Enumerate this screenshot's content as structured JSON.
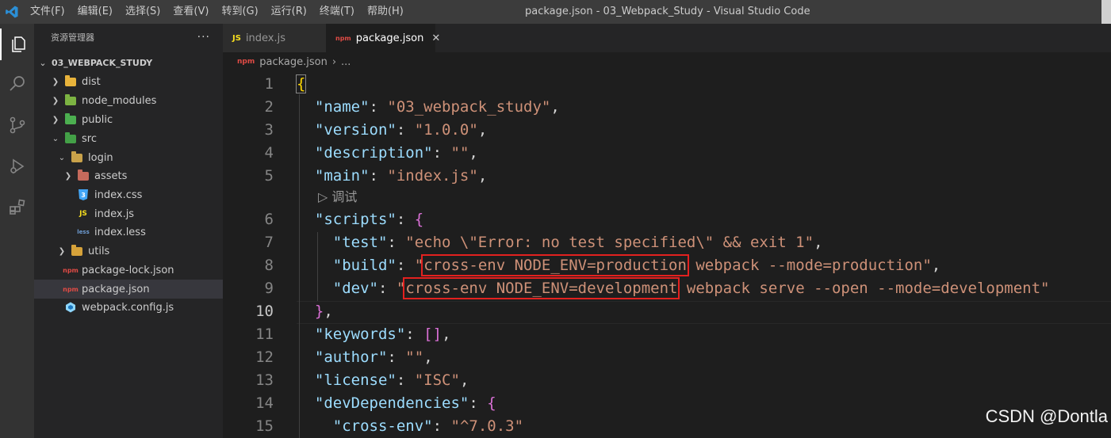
{
  "window": {
    "title": "package.json - 03_Webpack_Study - Visual Studio Code",
    "menu": [
      "文件(F)",
      "编辑(E)",
      "选择(S)",
      "查看(V)",
      "转到(G)",
      "运行(R)",
      "终端(T)",
      "帮助(H)"
    ]
  },
  "activity_bar": {
    "items": [
      {
        "icon": "files-icon",
        "active": true
      },
      {
        "icon": "search-icon",
        "active": false
      },
      {
        "icon": "source-control-icon",
        "active": false
      },
      {
        "icon": "run-debug-icon",
        "active": false
      },
      {
        "icon": "extensions-icon",
        "active": false
      }
    ]
  },
  "sidebar": {
    "title": "资源管理器",
    "more": "···",
    "project": "03_WEBPACK_STUDY",
    "tree": [
      {
        "label": "dist",
        "type": "folder",
        "state": "collapsed",
        "icon": "folder-dist-icon"
      },
      {
        "label": "node_modules",
        "type": "folder",
        "state": "collapsed",
        "icon": "folder-node-icon"
      },
      {
        "label": "public",
        "type": "folder",
        "state": "collapsed",
        "icon": "folder-public-icon"
      },
      {
        "label": "src",
        "type": "folder",
        "state": "expanded",
        "icon": "folder-src-icon"
      },
      {
        "label": "login",
        "type": "folder",
        "state": "expanded",
        "icon": "folder-icon"
      },
      {
        "label": "assets",
        "type": "folder",
        "state": "collapsed",
        "icon": "folder-images-icon"
      },
      {
        "label": "index.css",
        "type": "file",
        "icon": "css-file-icon"
      },
      {
        "label": "index.js",
        "type": "file",
        "icon": "js-file-icon"
      },
      {
        "label": "index.less",
        "type": "file",
        "icon": "less-file-icon"
      },
      {
        "label": "utils",
        "type": "folder",
        "state": "collapsed",
        "icon": "folder-utils-icon"
      },
      {
        "label": "package-lock.json",
        "type": "file",
        "icon": "npm-file-icon"
      },
      {
        "label": "package.json",
        "type": "file",
        "icon": "npm-file-icon",
        "selected": true
      },
      {
        "label": "webpack.config.js",
        "type": "file",
        "icon": "webpack-file-icon"
      }
    ]
  },
  "tabs": [
    {
      "label": "index.js",
      "icon_text": "JS",
      "active": false
    },
    {
      "label": "package.json",
      "icon_text": "npm",
      "active": true,
      "close": "✕"
    }
  ],
  "breadcrumb": {
    "file": "package.json",
    "more": "..."
  },
  "editor": {
    "codelens": "▷ 调试",
    "line_numbers": [
      "1",
      "2",
      "3",
      "4",
      "5",
      "6",
      "7",
      "8",
      "9",
      "10",
      "11",
      "12",
      "13",
      "14",
      "15"
    ],
    "current_line": "10",
    "lines": {
      "l1": "{",
      "l2k": "\"name\"",
      "l2v": "\"03_webpack_study\"",
      "l3k": "\"version\"",
      "l3v": "\"1.0.0\"",
      "l4k": "\"description\"",
      "l4v": "\"\"",
      "l5k": "\"main\"",
      "l5v": "\"index.js\"",
      "l6k": "\"scripts\"",
      "l6b": "{",
      "l7k": "\"test\"",
      "l7v": "\"echo \\\"Error: no test specified\\\" && exit 1\"",
      "l8k": "\"build\"",
      "l8q": "\"",
      "l8h": "cross-env NODE_ENV=production",
      "l8r": " webpack --mode=production\"",
      "l9k": "\"dev\"",
      "l9q": "\"",
      "l9h": "cross-env NODE_ENV=development",
      "l9r": " webpack serve --open --mode=development\"",
      "l10b": "}",
      "l11k": "\"keywords\"",
      "l11v": "[]",
      "l12k": "\"author\"",
      "l12v": "\"\"",
      "l13k": "\"license\"",
      "l13v": "\"ISC\"",
      "l14k": "\"devDependencies\"",
      "l14b": "{",
      "l15k": "\"cross-env\"",
      "l15v": "\"^7.0.3\""
    }
  },
  "watermark": "CSDN @Dontla",
  "colors": {
    "highlight_box": "#e3211f",
    "json_key": "#9cdcfe",
    "json_string": "#ce9178",
    "bracket_level1": "#ffd700",
    "bracket_level2": "#da70d6"
  }
}
